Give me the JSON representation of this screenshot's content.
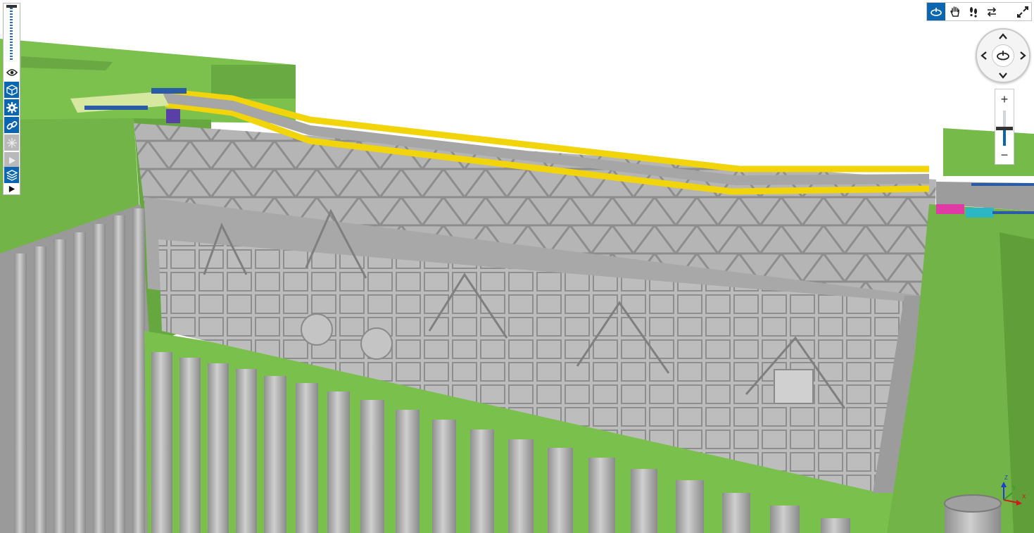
{
  "app": {
    "accent_color": "#0a66b0"
  },
  "left_toolbar": {
    "items": [
      {
        "icon": "eye-icon",
        "state": "normal"
      },
      {
        "icon": "cube-icon",
        "state": "active"
      },
      {
        "icon": "gear-icon",
        "state": "active"
      },
      {
        "icon": "link-icon",
        "state": "active"
      },
      {
        "icon": "sparkle-icon",
        "state": "disabled"
      },
      {
        "icon": "play-icon",
        "state": "disabled"
      },
      {
        "icon": "layers-cube-icon",
        "state": "active"
      },
      {
        "icon": "play-icon",
        "state": "normal"
      }
    ]
  },
  "nav_toolbar": {
    "items": [
      {
        "icon": "orbit-icon",
        "state": "active"
      },
      {
        "icon": "pan-hand-icon",
        "state": "normal"
      },
      {
        "icon": "walk-footsteps-icon",
        "state": "normal"
      },
      {
        "icon": "swap-arrows-icon",
        "state": "normal"
      },
      {
        "icon": "fit-view-icon",
        "state": "normal"
      }
    ]
  },
  "zoom": {
    "plus_label": "+",
    "minus_label": "−",
    "level": 0.5
  },
  "axes": {
    "x_label": "X",
    "y_label": "Y",
    "z_label": "Z"
  },
  "scene": {
    "ground_color": "#77b94a",
    "steel_color": "#a9a9a9",
    "rail_color": "#f2d40a"
  }
}
